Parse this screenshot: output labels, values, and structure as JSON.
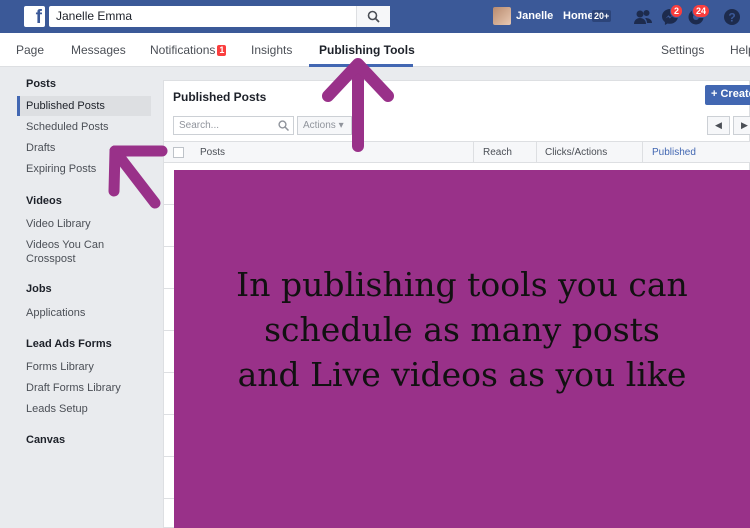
{
  "topbar": {
    "search_value": "Janelle Emma",
    "user_name": "Janelle",
    "home_label": "Home",
    "home_count": "20+",
    "messages_badge": "2",
    "notifications_badge": "24",
    "icons": [
      "facebook-logo-icon",
      "search-icon",
      "friend-requests-icon",
      "messenger-icon",
      "notifications-icon",
      "help-icon"
    ]
  },
  "pagenav": {
    "items": [
      "Page",
      "Messages",
      "Notifications",
      "Insights",
      "Publishing Tools"
    ],
    "notifications_badge": "1",
    "right_items": [
      "Settings",
      "Help"
    ]
  },
  "sidebar": {
    "posts_heading": "Posts",
    "posts_items": [
      "Published Posts",
      "Scheduled Posts",
      "Drafts",
      "Expiring Posts"
    ],
    "videos_heading": "Videos",
    "videos_items": [
      "Video Library",
      "Videos You Can Crosspost"
    ],
    "jobs_heading": "Jobs",
    "jobs_items": [
      "Applications"
    ],
    "lead_heading": "Lead Ads Forms",
    "lead_items": [
      "Forms Library",
      "Draft Forms Library",
      "Leads Setup"
    ],
    "canvas_heading": "Canvas"
  },
  "main": {
    "title": "Published Posts",
    "create_label": "+ Create",
    "search_placeholder": "Search...",
    "actions_label": "Actions ▾",
    "columns": [
      "Posts",
      "Reach",
      "Clicks/Actions",
      "Published"
    ]
  },
  "overlay": {
    "lines": [
      "In publishing tools you can",
      "schedule as many posts",
      "and Live videos as you like"
    ],
    "color": "#993189"
  },
  "colors": {
    "fb_blue": "#3b5998",
    "accent": "#4267b2",
    "arrow": "#993189"
  }
}
